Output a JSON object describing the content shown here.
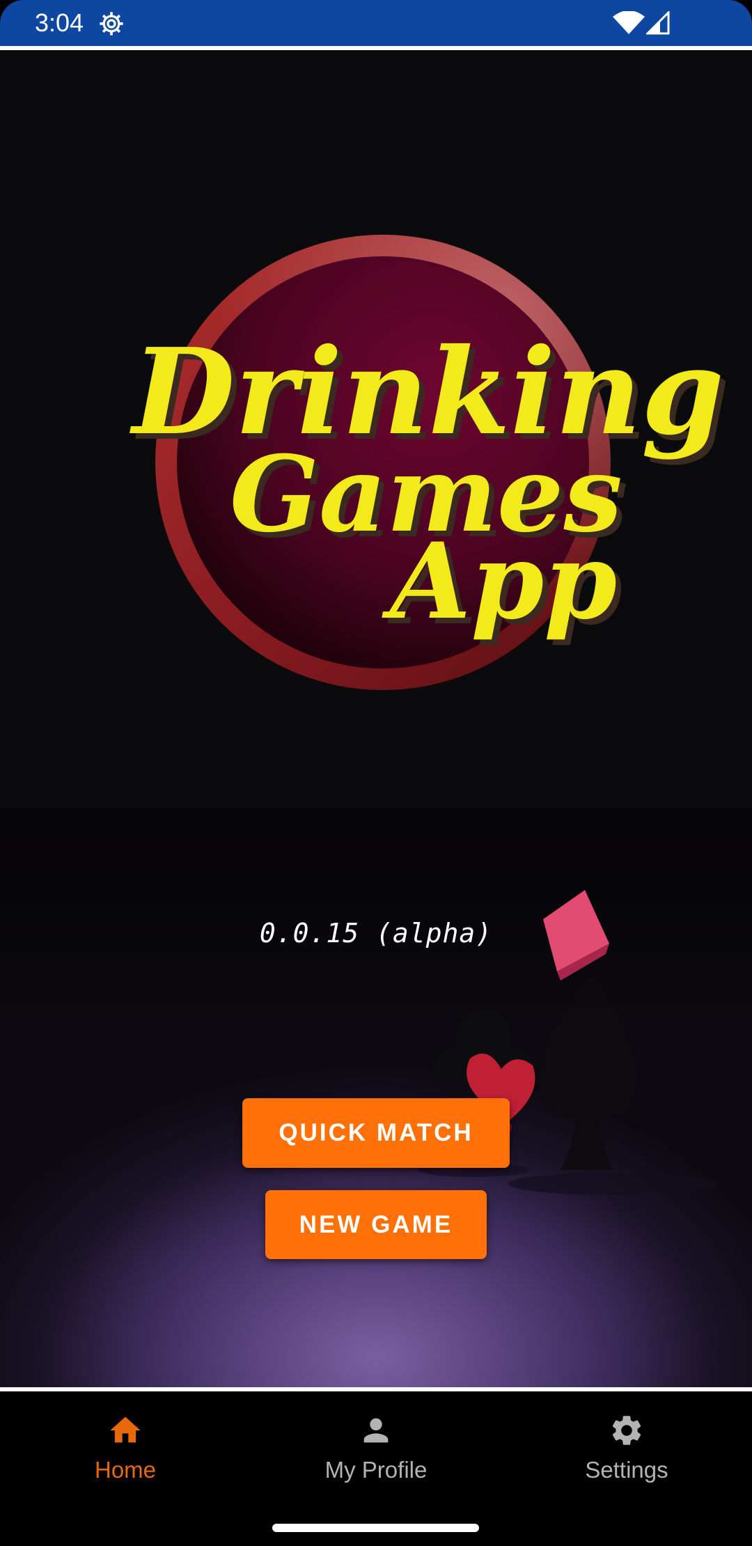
{
  "status_bar": {
    "time": "3:04",
    "icons": [
      "settings-gear-icon",
      "wifi-icon",
      "cell-signal-icon"
    ]
  },
  "logo": {
    "line1": "Drinking",
    "line2": "Games",
    "line3": "App"
  },
  "version": "0.0.15 (alpha)",
  "buttons": {
    "quick_match": "QUICK MATCH",
    "new_game": "NEW GAME"
  },
  "nav": {
    "items": [
      {
        "label": "Home",
        "icon": "home-icon",
        "active": true
      },
      {
        "label": "My Profile",
        "icon": "person-icon",
        "active": false
      },
      {
        "label": "Settings",
        "icon": "gear-icon",
        "active": false
      }
    ]
  },
  "colors": {
    "status_bar": "#0d47a1",
    "accent": "#ff7008",
    "nav_active": "#e8680c",
    "nav_inactive": "#b3b3b3",
    "logo_text": "#f2ea1a",
    "logo_disc": "#6a0a2e"
  }
}
